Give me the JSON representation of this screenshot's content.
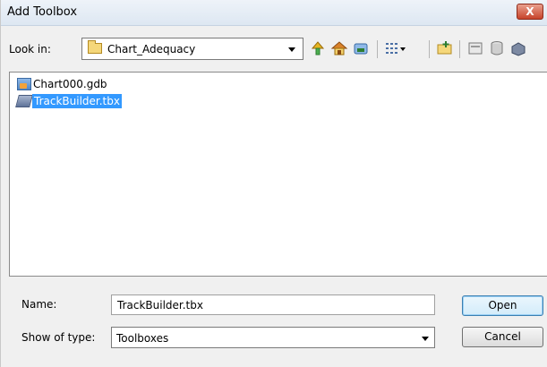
{
  "window": {
    "title": "Add Toolbox",
    "close_label": "X"
  },
  "look_in": {
    "label": "Look in:",
    "value": "Chart_Adequacy"
  },
  "toolbar": {
    "icons": [
      "up-one-level-icon",
      "home-icon",
      "connect-folder-icon",
      "view-menu-icon",
      "new-folder-icon",
      "catalog-icon",
      "database-icon",
      "toolbox-icon"
    ]
  },
  "files": [
    {
      "name": "Chart000.gdb",
      "icon": "geodatabase-icon",
      "selected": false
    },
    {
      "name": "TrackBuilder.tbx",
      "icon": "toolbox-icon",
      "selected": true
    }
  ],
  "name_field": {
    "label": "Name:",
    "value": "TrackBuilder.tbx"
  },
  "type_field": {
    "label": "Show of type:",
    "value": "Toolboxes"
  },
  "buttons": {
    "open": "Open",
    "cancel": "Cancel"
  },
  "colors": {
    "selection": "#3399ff",
    "close": "#c7432a"
  }
}
